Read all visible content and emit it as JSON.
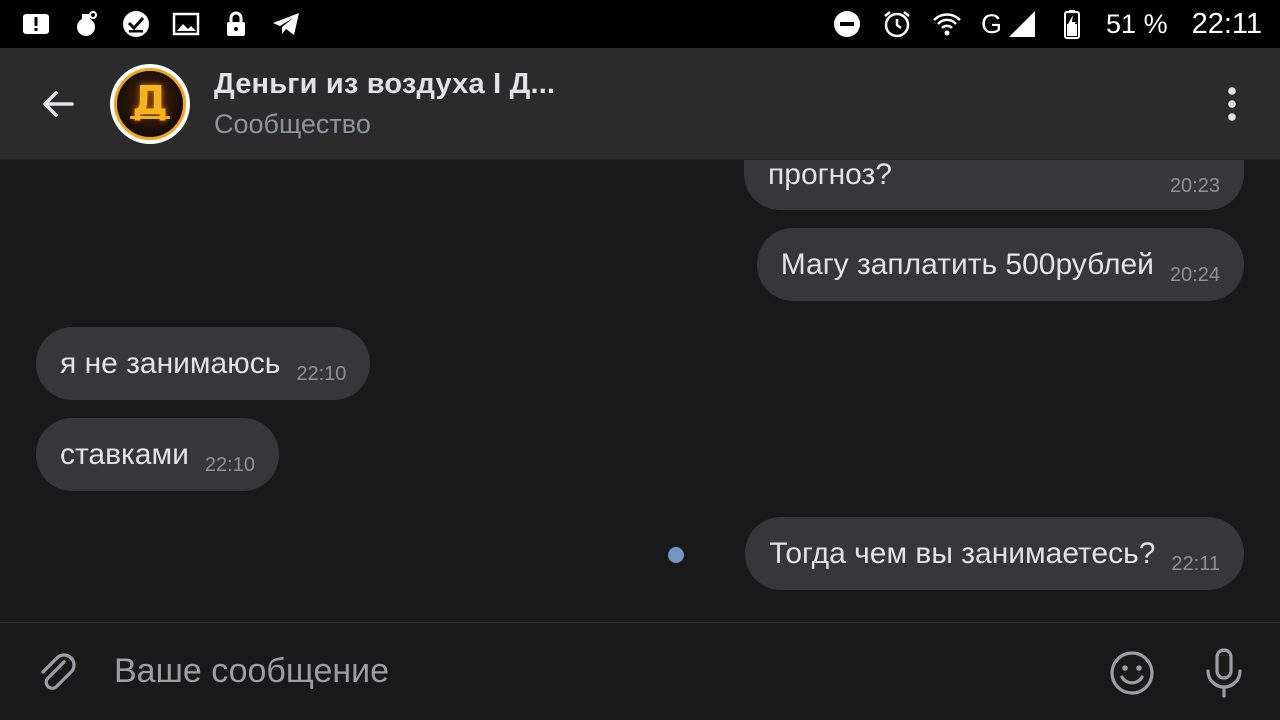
{
  "statusbar": {
    "battery_percent": "51 %",
    "time": "22:11",
    "network_label": "G",
    "left_icons": [
      "notification-alert-icon",
      "hand-grenade-icon",
      "check-badge-icon",
      "image-icon",
      "lock-icon",
      "telegram-icon"
    ],
    "right_icons": [
      "do-not-disturb-icon",
      "alarm-clock-icon",
      "wifi-icon",
      "signal-icon",
      "battery-charging-icon"
    ]
  },
  "header": {
    "title": "Деньги из воздуха I Д...",
    "subtitle": "Сообщество",
    "avatar_letter": "Д"
  },
  "messages": [
    {
      "text": "прогноз?",
      "time": "20:23",
      "direction": "outgoing"
    },
    {
      "text": "Магу заплатить 500рублей",
      "time": "20:24",
      "direction": "outgoing"
    },
    {
      "text": "я не занимаюсь",
      "time": "22:10",
      "direction": "incoming"
    },
    {
      "text": "ставками",
      "time": "22:10",
      "direction": "incoming"
    },
    {
      "text": "Тогда чем вы занимаетесь?",
      "time": "22:11",
      "direction": "outgoing",
      "unread": true
    }
  ],
  "composer": {
    "placeholder": "Ваше сообщение"
  },
  "colors": {
    "background": "#19191a",
    "header": "#2b2b2c",
    "bubble": "#363738",
    "unread_dot": "#7495c1",
    "avatar_accent": "#f2a718"
  }
}
